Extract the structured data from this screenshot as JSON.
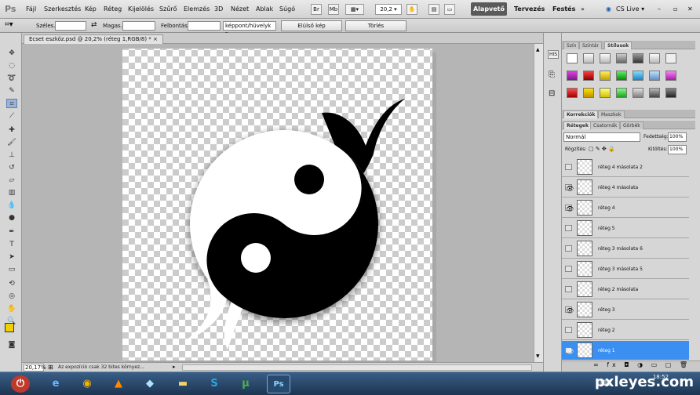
{
  "app": {
    "logo": "Ps"
  },
  "menu": [
    "Fájl",
    "Szerkesztés",
    "Kép",
    "Réteg",
    "Kijelölés",
    "Szűrő",
    "Elemzés",
    "3D",
    "Nézet",
    "Ablak",
    "Súgó"
  ],
  "menubar": {
    "zoom": "20,2",
    "workspace_active": "Alapvető",
    "workspaces": [
      "Tervezés",
      "Festés"
    ],
    "more": "»",
    "cs_live": "CS Live ▾"
  },
  "options": {
    "width_label": "Széles.:",
    "height_label": "Magas.:",
    "resolution_label": "Felbontás:",
    "unit_select": "képpont/hüvelyk",
    "front_image_button": "Elülső kép",
    "clear_button": "Törlés"
  },
  "document": {
    "tab_title": "Ecset eszköz.psd @ 20,2% (réteg 1,RGB/8) *",
    "close": "×"
  },
  "status": {
    "zoom": "20,17%",
    "text": "Az expozíció csak 32 bites környez..."
  },
  "panels": {
    "swatch_tabs": [
      "Szín",
      "Színtár",
      "Stílusok"
    ],
    "adjust_tabs": [
      "Korrekciók",
      "Maszkok"
    ],
    "layer_tabs": [
      "Rétegek",
      "Csatornák",
      "Görbék"
    ],
    "blend_mode": "Normál",
    "opacity_label": "Fedettség:",
    "opacity_value": "100%",
    "lock_label": "Rögzítés:",
    "fill_label": "Kitöltés:",
    "fill_value": "100%"
  },
  "layers": [
    {
      "name": "réteg 4 másolata 2",
      "visible": false,
      "selected": false
    },
    {
      "name": "réteg 4 másolata",
      "visible": true,
      "selected": false
    },
    {
      "name": "réteg 4",
      "visible": true,
      "selected": false
    },
    {
      "name": "réteg 5",
      "visible": false,
      "selected": false
    },
    {
      "name": "réteg 3 másolata 6",
      "visible": false,
      "selected": false
    },
    {
      "name": "réteg 3 másolata 5",
      "visible": false,
      "selected": false
    },
    {
      "name": "réteg 2 másolata",
      "visible": false,
      "selected": false
    },
    {
      "name": "réteg 3",
      "visible": true,
      "selected": false
    },
    {
      "name": "réteg 2",
      "visible": false,
      "selected": false
    },
    {
      "name": "réteg 1",
      "visible": true,
      "selected": true
    }
  ],
  "taskbar": {
    "watermark": "pxleyes.com",
    "time": "18:52"
  },
  "colors": {
    "selected_layer": "#3a8ff0",
    "foreground": "#f0d000",
    "background": "#000000"
  }
}
